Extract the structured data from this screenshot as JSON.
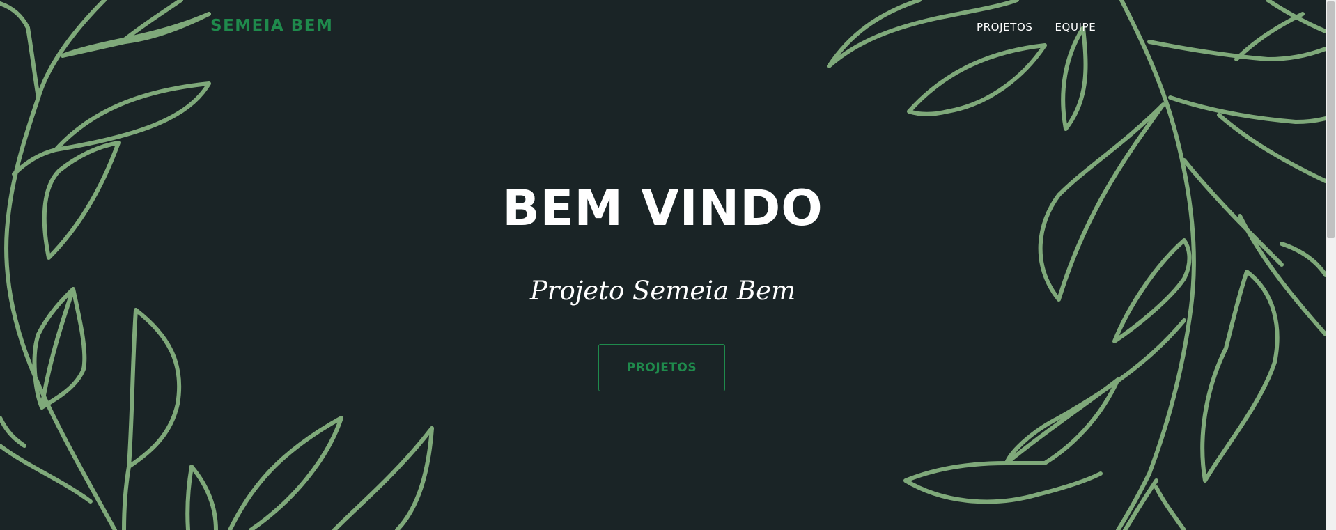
{
  "header": {
    "brand": "SEMEIA BEM",
    "nav": [
      {
        "label": "PROJETOS"
      },
      {
        "label": "EQUIPE"
      }
    ]
  },
  "hero": {
    "title": "BEM VINDO",
    "subtitle": "Projeto Semeia Bem",
    "button_label": "PROJETOS"
  },
  "colors": {
    "background": "#1a2426",
    "accent_green": "#1f8a4c",
    "leaf_stroke": "#7fa97a",
    "text": "#ffffff"
  },
  "icons": {
    "background": "leaf-pattern"
  }
}
